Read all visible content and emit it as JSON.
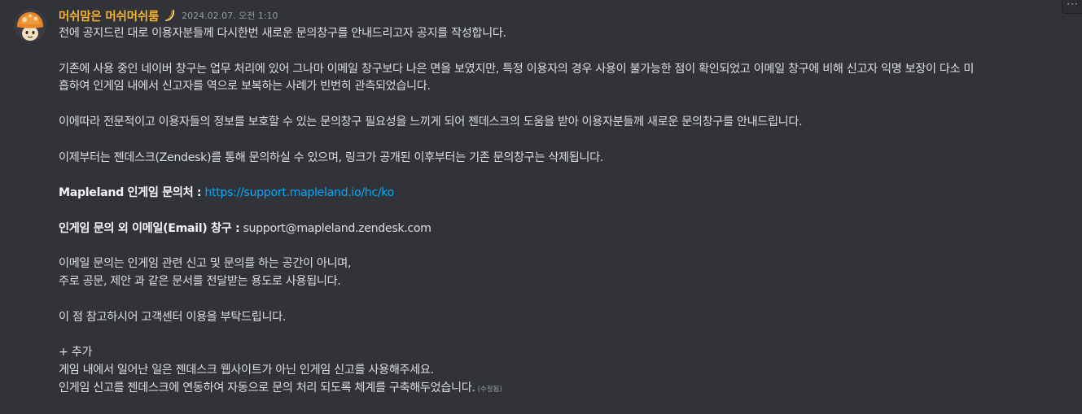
{
  "message": {
    "username": "머쉬맘은 머쉬머쉬룸",
    "role_icon": "banana-icon",
    "timestamp": "2024.02.07. 오전 1:10",
    "more_label": "···",
    "paragraphs": {
      "p1": "전에 공지드린 대로 이용자분들께 다시한번 새로운 문의창구를 안내드리고자 공지를 작성합니다.",
      "p2_line1": "기존에 사용 중인 네이버 창구는 업무 처리에 있어 그나마 이메일 창구보다 나은 면을 보였지만, 특정 이용자의 경우 사용이 불가능한 점이 확인되었고 이메일 창구에 비해 신고자 익명 보장이 다소 미",
      "p2_line2": "흡하여 인게임 내에서 신고자를 역으로 보복하는 사례가 빈번히 관측되었습니다.",
      "p3": "이에따라 전문적이고 이용자들의 정보를 보호할 수 있는 문의창구 필요성을 느끼게 되어 젠데스크의 도움을 받아 이용자분들께 새로운 문의창구를 안내드립니다.",
      "p4": "이제부터는 젠데스크(Zendesk)를 통해 문의하실 수 있으며, 링크가 공개된 이후부터는 기존 문의창구는 삭제됩니다.",
      "inquiry_label": "Mapleland 인게임 문의처 :",
      "inquiry_link": "https://support.mapleland.io/hc/ko",
      "email_label": "인게임 문의 외 이메일(Email) 창구 :",
      "email_value": "support@mapleland.zendesk.com",
      "p7_line1": "이메일 문의는 인게임 관련 신고 및 문의를 하는 공간이 아니며,",
      "p7_line2": "주로 공문, 제안 과 같은 문서를 전달받는 용도로 사용됩니다.",
      "p8": "이 점 참고하시어 고객센터 이용을 부탁드립니다.",
      "addendum_title": "+ 추가",
      "addendum_line1": "게임 내에서 일어난 일은 젠데스크 웹사이트가 아닌 인게임 신고를 사용해주세요.",
      "addendum_line2": "인게임 신고를 젠데스크에 연동하여 자동으로 문의 처리 되도록 체계를 구축해두었습니다.",
      "edited_label": "(수정됨)"
    }
  },
  "colors": {
    "background": "#313338",
    "username": "#f0b232",
    "text": "#dbdee1",
    "link": "#00a8fc",
    "muted": "#949ba4"
  }
}
